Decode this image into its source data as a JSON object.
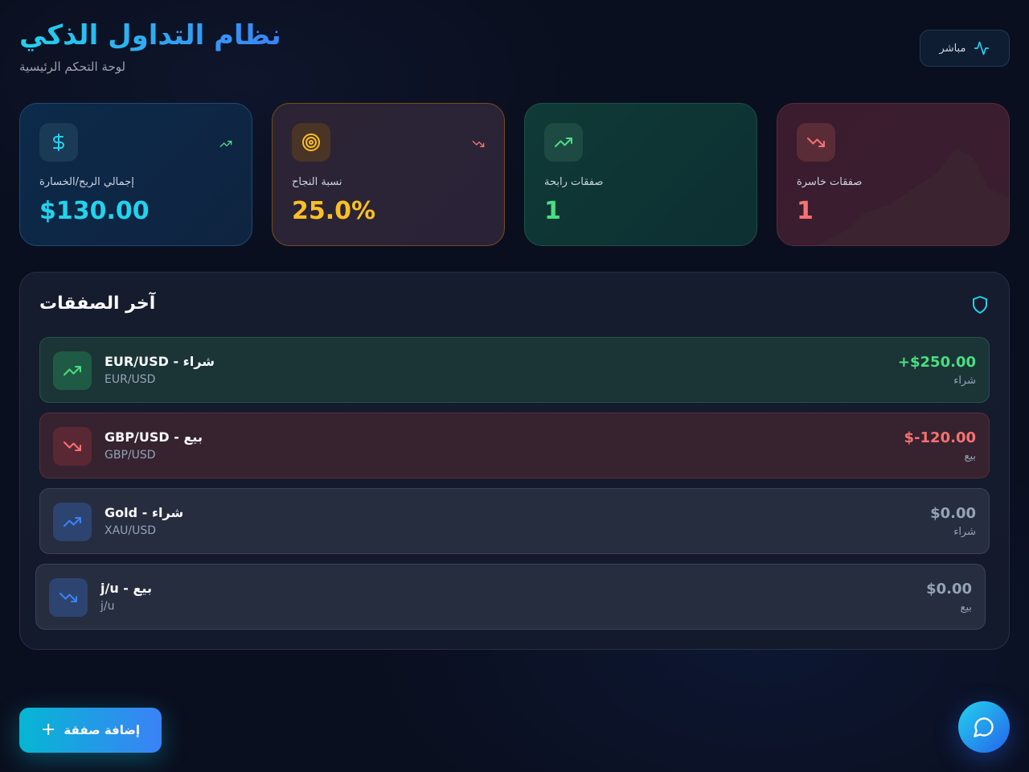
{
  "header": {
    "title": "نظام التداول الذكي",
    "subtitle": "لوحة التحكم الرئيسية",
    "live_label": "مباشر"
  },
  "stats": [
    {
      "label": "إجمالي الربح/الخسارة",
      "value": "$130.00",
      "icon": "dollar-icon",
      "color": "#22d3ee"
    },
    {
      "label": "نسبة النجاح",
      "value": "25.0%",
      "icon": "target-icon",
      "color": "#fbbf24"
    },
    {
      "label": "صفقات رابحة",
      "value": "1",
      "icon": "trending-up-icon",
      "color": "#4ade80"
    },
    {
      "label": "صفقات خاسرة",
      "value": "1",
      "icon": "trending-down-icon",
      "color": "#f87171"
    }
  ],
  "trades_panel": {
    "title": "آخر الصفقات",
    "trades": [
      {
        "name": "EUR/USD - شراء",
        "symbol": "EUR/USD",
        "amount": "+$250.00",
        "side": "شراء",
        "icon": "trending-up-icon"
      },
      {
        "name": "GBP/USD - بيع",
        "symbol": "GBP/USD",
        "amount": "$-120.00",
        "side": "بيع",
        "icon": "trending-down-icon"
      },
      {
        "name": "Gold - شراء",
        "symbol": "XAU/USD",
        "amount": "$0.00",
        "side": "شراء",
        "icon": "trending-up-icon"
      },
      {
        "name": "j/u - بيع",
        "symbol": "j/u",
        "amount": "$0.00",
        "side": "بيع",
        "icon": "trending-down-icon"
      }
    ]
  },
  "actions": {
    "add_trade_label": "إضافة صفقة"
  },
  "colors": {
    "accent": "#22d3ee",
    "profit": "#4ade80",
    "loss": "#f87171",
    "warning": "#fbbf24",
    "primary": "#3b82f6"
  }
}
